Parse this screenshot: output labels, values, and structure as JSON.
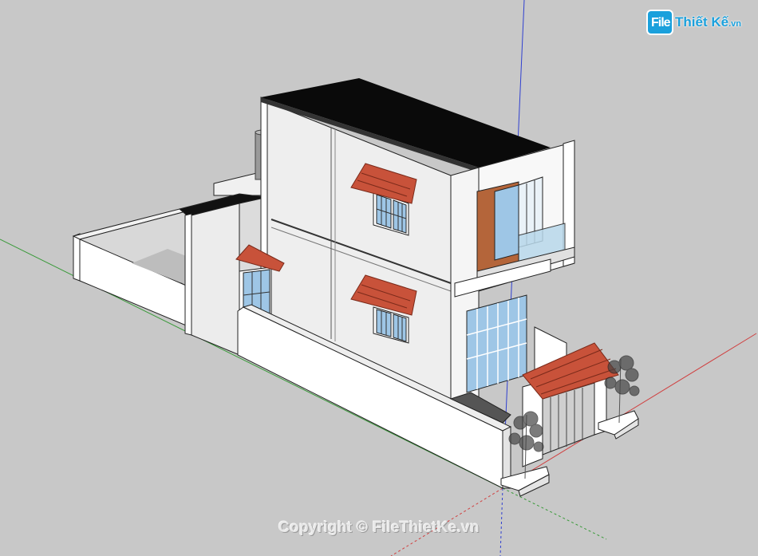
{
  "watermark": {
    "logo_file": "File",
    "logo_rest": "Thiết Kế",
    "logo_tld": ".vn",
    "copyright": "Copyright © FileThietKe.vn"
  },
  "scene": {
    "description_icon": "house-3d-model-icon",
    "background_color": "#c8c8c8",
    "roof_color": "#0a0a0a",
    "awning_color": "#c8523a",
    "brick_color": "#b4653a",
    "glass_color": "#9ec6e6",
    "axis_colors": {
      "red": "#d04040",
      "green": "#3a9a3a",
      "blue": "#3040d0"
    }
  }
}
